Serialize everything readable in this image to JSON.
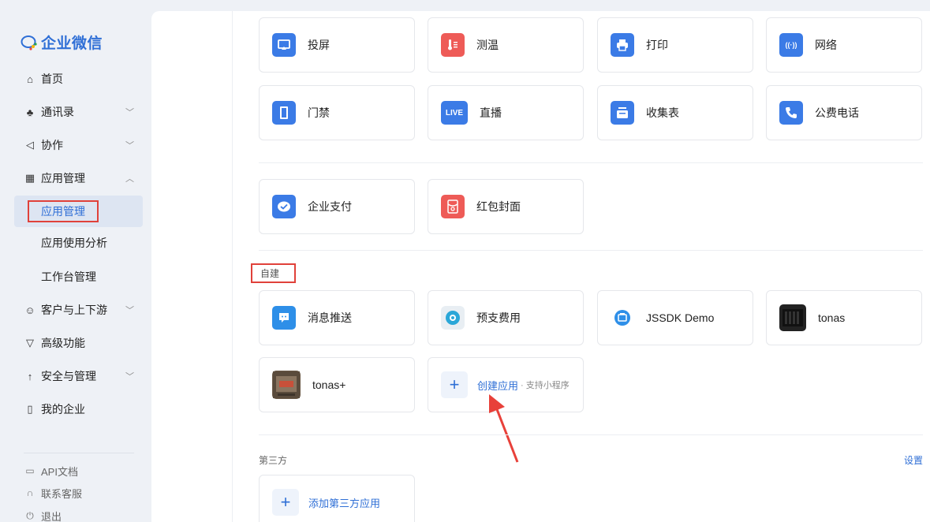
{
  "brand": {
    "name": "企业微信"
  },
  "sidebar": {
    "items": [
      {
        "label": "首页",
        "icon": "home-icon"
      },
      {
        "label": "通讯录",
        "icon": "contacts-icon",
        "chevron": "﹀"
      },
      {
        "label": "协作",
        "icon": "collab-icon",
        "chevron": "﹀"
      },
      {
        "label": "应用管理",
        "icon": "apps-icon",
        "chevron": "︿"
      }
    ],
    "sub_items": [
      {
        "label": "应用管理"
      },
      {
        "label": "应用使用分析"
      },
      {
        "label": "工作台管理"
      }
    ],
    "items2": [
      {
        "label": "客户与上下游",
        "icon": "customer-icon",
        "chevron": "﹀"
      },
      {
        "label": "高级功能",
        "icon": "advanced-icon"
      },
      {
        "label": "安全与管理",
        "icon": "security-icon",
        "chevron": "﹀"
      },
      {
        "label": "我的企业",
        "icon": "company-icon"
      }
    ],
    "footer": [
      {
        "label": "API文档",
        "icon": "doc-icon"
      },
      {
        "label": "联系客服",
        "icon": "headset-icon"
      },
      {
        "label": "退出",
        "icon": "power-icon"
      }
    ]
  },
  "apps_row1": [
    {
      "label": "投屏",
      "icon": "screen-cast-icon",
      "color": "#3b7be6"
    },
    {
      "label": "测温",
      "icon": "thermometer-icon",
      "color": "#ee5b57"
    },
    {
      "label": "打印",
      "icon": "printer-icon",
      "color": "#3b7be6"
    },
    {
      "label": "网络",
      "icon": "network-icon",
      "color": "#3b7be6"
    }
  ],
  "apps_row2": [
    {
      "label": "门禁",
      "icon": "door-icon",
      "color": "#3b7be6"
    },
    {
      "label": "直播",
      "icon": "live-icon",
      "icon_text": "LIVE",
      "color": "#3b7be6"
    },
    {
      "label": "收集表",
      "icon": "form-icon",
      "color": "#3b7be6"
    },
    {
      "label": "公费电话",
      "icon": "phone-icon",
      "color": "#3b7be6"
    }
  ],
  "apps_row3": [
    {
      "label": "企业支付",
      "icon": "pay-icon",
      "color": "#3b7be6"
    },
    {
      "label": "红包封面",
      "icon": "red-packet-icon",
      "color": "#ee5b57"
    }
  ],
  "custom": {
    "title": "自建",
    "apps": [
      {
        "label": "消息推送",
        "icon": "message-push-icon",
        "color": "#2e8fe8"
      },
      {
        "label": "预支费用",
        "icon": "advance-fee-icon",
        "color": "#2aa7d8"
      },
      {
        "label": "JSSDK Demo",
        "icon": "jssdk-icon",
        "color": "#2e8fe8"
      },
      {
        "label": "tonas",
        "icon": "tonas-icon",
        "color": "#222222"
      },
      {
        "label": "tonas+",
        "icon": "tonas-plus-icon",
        "color": "#6b5a48"
      }
    ],
    "create": {
      "label": "创建应用",
      "hint": "· 支持小程序"
    }
  },
  "third_party": {
    "title": "第三方",
    "settings": "设置",
    "add_label": "添加第三方应用"
  }
}
